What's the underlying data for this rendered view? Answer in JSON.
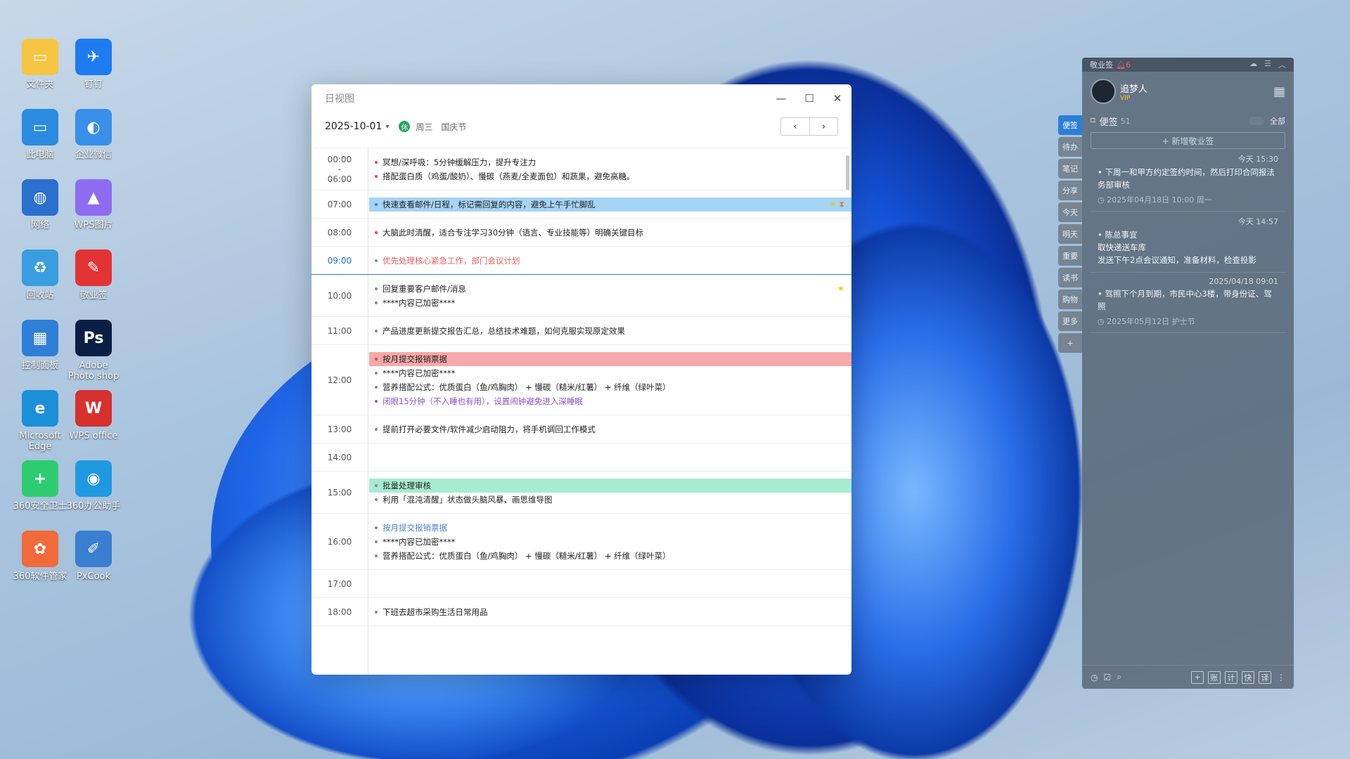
{
  "colors": {
    "accent": "#2b7fd6",
    "event_blue": "#a6d4f5",
    "event_pink": "#f7a9a9",
    "event_green": "#a7ecd1",
    "dot_red": "#e84545",
    "dot_blue": "#2f7fd8",
    "dot_purple": "#9b59b6",
    "dot_gray": "#888888",
    "urgent_text": "#e85c5c",
    "purple_text": "#8e4fd1",
    "link_text": "#4a7fd0"
  },
  "desktop_icons": [
    {
      "label": "文件夹",
      "icon": "folder-icon"
    },
    {
      "label": "钉钉",
      "icon": "dingtalk-icon"
    },
    {
      "label": "此电脑",
      "icon": "computer-icon"
    },
    {
      "label": "企业微信",
      "icon": "wecom-icon"
    },
    {
      "label": "网络",
      "icon": "network-icon"
    },
    {
      "label": "WPS图片",
      "icon": "wps-picture-icon"
    },
    {
      "label": "回收站",
      "icon": "recycle-bin-icon"
    },
    {
      "label": "敬业签",
      "icon": "jingyeqian-icon"
    },
    {
      "label": "控制面板",
      "icon": "control-panel-icon"
    },
    {
      "label": "Adobe\nPhoto shop",
      "icon": "photoshop-icon"
    },
    {
      "label": "Microsoft\nEdge",
      "icon": "edge-icon"
    },
    {
      "label": "WPS office",
      "icon": "wps-office-icon"
    },
    {
      "label": "360安全卫士",
      "icon": "360-security-icon"
    },
    {
      "label": "360办公助手",
      "icon": "360-office-icon"
    },
    {
      "label": "360软件管家",
      "icon": "360-software-icon"
    },
    {
      "label": "PxCook",
      "icon": "pxcook-icon"
    }
  ],
  "calendar": {
    "window_title": "日视图",
    "date": "2025-10-01",
    "holiday_badge": "休",
    "weekday": "周三",
    "holiday": "国庆节",
    "prev": "‹",
    "next": "›",
    "rows": [
      {
        "time": "00:00\n-\n06:00",
        "events": [
          {
            "text": "冥想/深呼吸：5分钟缓解压力，提升专注力",
            "dot": "red"
          },
          {
            "text": "搭配蛋白质（鸡蛋/酸奶）、慢碳（燕麦/全麦面包）和蔬果，避免高糖。",
            "dot": "red"
          }
        ]
      },
      {
        "time": "07:00",
        "events": [
          {
            "text": "快速查看邮件/日程，标记需回复的内容，避免上午手忙脚乱",
            "dot": "blue",
            "bg": "blue",
            "icons": [
              "star-icon",
              "hourglass-icon"
            ]
          }
        ]
      },
      {
        "time": "08:00",
        "events": [
          {
            "text": "大脑此时清醒，适合专注学习30分钟（语言、专业技能等）明确关键目标",
            "dot": "red"
          }
        ]
      },
      {
        "time": "09:00",
        "current": true,
        "events": [
          {
            "text": "优先处理核心紧急工作，部门会议计划",
            "dot": "gray",
            "style": "urgent"
          }
        ]
      },
      {
        "time": "10:00",
        "events": [
          {
            "text": "回复重要客户邮件/消息",
            "dot": "gray",
            "icons": [
              "star-icon"
            ]
          },
          {
            "text": "****内容已加密****",
            "dot": "gray"
          }
        ]
      },
      {
        "time": "11:00",
        "events": [
          {
            "text": "产品进度更新提交报告汇总，总结技术难题，如何克服实现原定效果",
            "dot": "gray"
          }
        ]
      },
      {
        "time": "12:00",
        "events": [
          {
            "text": "按月提交报销票据",
            "dot": "red",
            "bg": "pink"
          },
          {
            "text": "****内容已加密****",
            "dot": "gray"
          },
          {
            "text": "营养搭配公式：优质蛋白（鱼/鸡胸肉） + 慢碳（糙米/红薯） + 纤维（绿叶菜）",
            "dot": "gray"
          },
          {
            "text": "闭眼15分钟（不入睡也有用），设置闹钟避免进入深睡眠",
            "dot": "purple",
            "style": "purple"
          }
        ]
      },
      {
        "time": "13:00",
        "events": [
          {
            "text": "提前打开必要文件/软件减少启动阻力，将手机调回工作模式",
            "dot": "gray"
          }
        ]
      },
      {
        "time": "14:00",
        "events": []
      },
      {
        "time": "15:00",
        "events": [
          {
            "text": "批量处理审核",
            "dot": "gray",
            "bg": "green"
          },
          {
            "text": "利用「混沌清醒」状态做头脑风暴、画思维导图",
            "dot": "gray"
          }
        ]
      },
      {
        "time": "16:00",
        "events": [
          {
            "text": "按月提交报销票据",
            "dot": "gray",
            "style": "link"
          },
          {
            "text": "****内容已加密****",
            "dot": "gray"
          },
          {
            "text": "营养搭配公式：优质蛋白（鱼/鸡胸肉） + 慢碳（糙米/红薯） + 纤维（绿叶菜）",
            "dot": "gray"
          }
        ]
      },
      {
        "time": "17:00",
        "events": []
      },
      {
        "time": "18:00",
        "events": [
          {
            "text": "下班去超市采购生活日常用品",
            "dot": "gray"
          }
        ]
      }
    ]
  },
  "sticky": {
    "app_name": "敬业签",
    "alert_count": "6",
    "username": "追梦人",
    "vip": "VIP",
    "list_title": "便签",
    "list_count": "51",
    "filter": "全部",
    "new_note": "+ 新增敬业签",
    "tabs": [
      "便签",
      "待办",
      "笔记",
      "分享",
      "今天",
      "明天",
      "重要",
      "读书",
      "购物",
      "更多",
      "+"
    ],
    "notes": [
      {
        "stamp": "今天 15:30",
        "text": "下周一和甲方约定签约时间，然后打印合同报法务部审核",
        "meta": "2025年04月18日 10:00 周一"
      },
      {
        "stamp": "今天 14:57",
        "text": "陈总事宜\n取快递送车库\n发送下午2点会议通知，准备材料，检查投影",
        "meta": ""
      },
      {
        "stamp": "2025/04/18 09:01",
        "text": "驾照下个月到期，市民中心3楼，带身份证、驾照",
        "meta": "2025年05月12日 护士节"
      }
    ],
    "bottom_buttons": [
      "账",
      "计",
      "快",
      "译"
    ]
  }
}
